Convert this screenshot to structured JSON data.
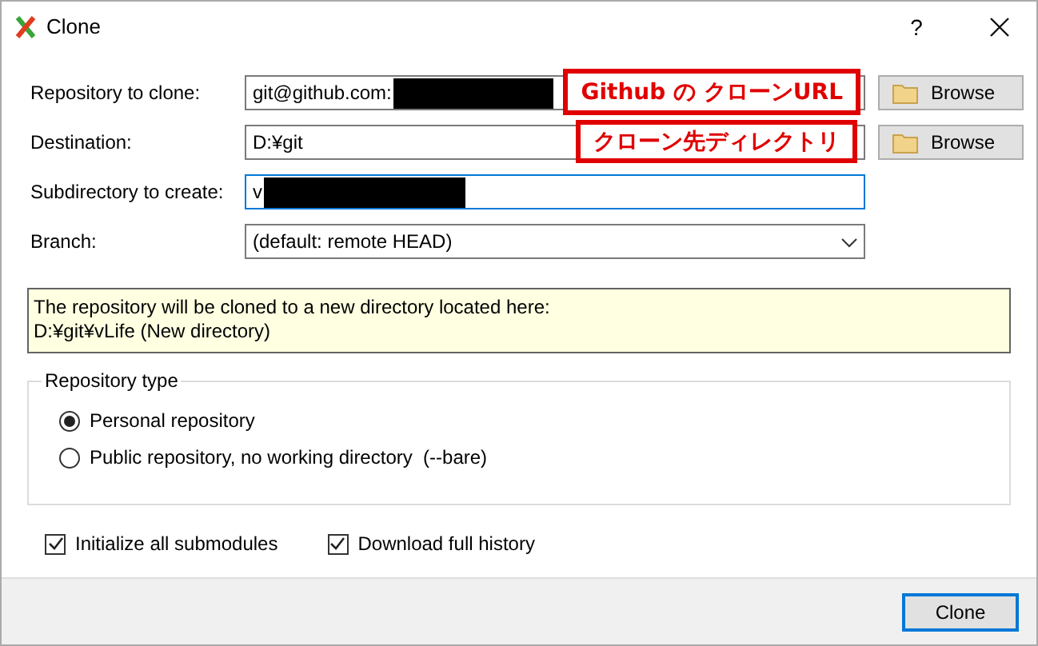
{
  "window": {
    "title": "Clone",
    "help": "?"
  },
  "fields": [
    {
      "label": "Repository to clone:",
      "kind": "text",
      "value": "git@github.com:",
      "redacted": true,
      "focused": false,
      "button": "Browse",
      "annotation": "Github の クローンURL"
    },
    {
      "label": "Destination:",
      "kind": "text",
      "value": "D:¥git",
      "focused": false,
      "button": "Browse",
      "annotation": "クローン先ディレクトリ"
    },
    {
      "label": "Subdirectory to create:",
      "kind": "text",
      "value": "v",
      "redacted": true,
      "focused": true
    },
    {
      "label": "Branch:",
      "kind": "dropdown",
      "value": "(default: remote HEAD)",
      "focused": false
    }
  ],
  "info": {
    "lines": [
      "The repository will be cloned to a new directory located here:",
      "D:¥git¥vLife (New directory)"
    ]
  },
  "repository_type": {
    "title": "Repository type",
    "options": [
      {
        "label": "Personal repository",
        "selected": true
      },
      {
        "label": "Public repository, no working directory  (--bare)",
        "selected": false
      }
    ]
  },
  "options": [
    {
      "label": "Initialize all submodules",
      "checked": true
    },
    {
      "label": "Download full history",
      "checked": true
    }
  ],
  "buttons": [
    {
      "label": "Clone",
      "default": true
    }
  ]
}
